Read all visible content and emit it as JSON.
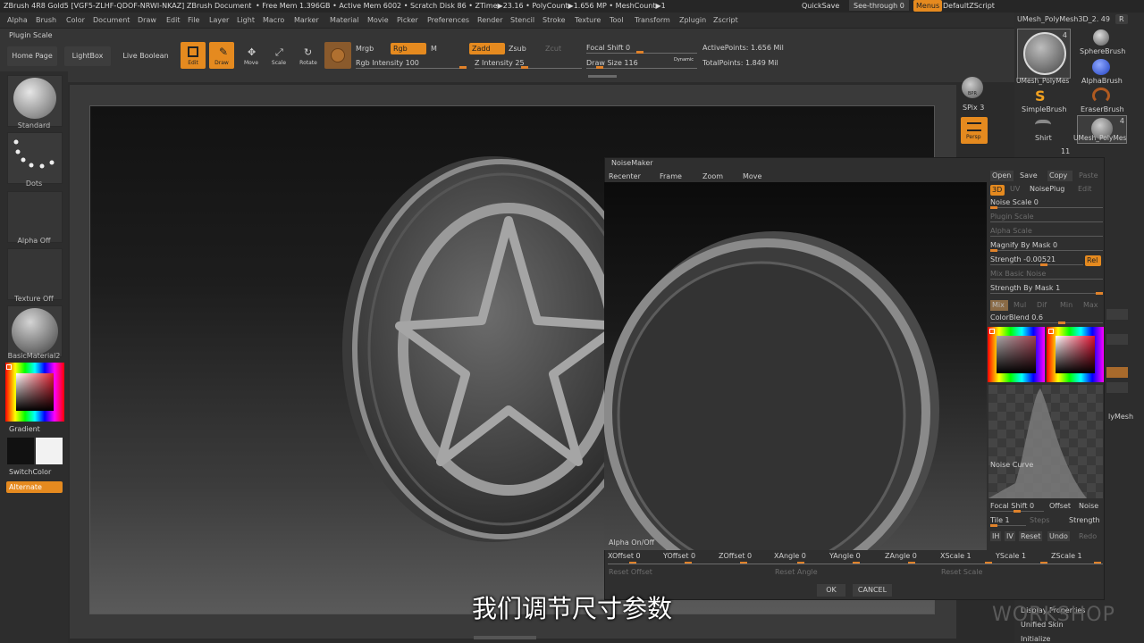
{
  "titlebar": {
    "app": "ZBrush 4R8 Gold5 [VGF5-ZLHF-QDOF-NRWI-NKAZ]  ZBrush Document",
    "stats": "• Free Mem 1.396GB • Active Mem 6002 • Scratch Disk 86 • ZTime▶23.16 • PolyCount▶1.656 MP • MeshCount▶1",
    "quicksave": "QuickSave",
    "seethrough": "See-through  0",
    "menus": "Menus",
    "script": "DefaultZScript"
  },
  "menubar": [
    "Alpha",
    "Brush",
    "Color",
    "Document",
    "Draw",
    "Edit",
    "File",
    "Layer",
    "Light",
    "Macro",
    "Marker",
    "Material",
    "Movie",
    "Picker",
    "Preferences",
    "Render",
    "Stencil",
    "Stroke",
    "Texture",
    "Tool",
    "Transform",
    "Zplugin",
    "Zscript"
  ],
  "shelf": {
    "plugin_scale": "Plugin Scale",
    "home_page": "Home Page",
    "lightbox": "LightBox",
    "live_boolean": "Live Boolean",
    "edit": "Edit",
    "draw": "Draw",
    "move": "Move",
    "scale": "Scale",
    "rotate": "Rotate",
    "mrgb": "Mrgb",
    "rgb": "Rgb",
    "m": "M",
    "rgb_intensity": "Rgb Intensity 100",
    "zadd": "Zadd",
    "zsub": "Zsub",
    "zcut": "Zcut",
    "z_intensity": "Z Intensity 25",
    "focal_shift": "Focal Shift 0",
    "draw_size": "Draw Size 116",
    "dynamic": "Dynamic",
    "active_points": "ActivePoints: 1.656 Mil",
    "total_points": "TotalPoints: 1.849 Mil"
  },
  "left": {
    "standard": "Standard",
    "dots": "Dots",
    "alpha_off": "Alpha Off",
    "texture_off": "Texture Off",
    "material": "BasicMaterial2",
    "gradient": "Gradient",
    "switchcolor": "SwitchColor",
    "alternate": "Alternate"
  },
  "canvas_right": {
    "bpr": "BPR",
    "spix": "SPix 3",
    "persp": "Persp"
  },
  "tool_panel": {
    "mesh_title": "UMesh_PolyMesh3D_2. 49",
    "r": "R",
    "items": [
      {
        "label": "UMesh_PolyMes",
        "count": "4"
      },
      {
        "label": "SphereBrush"
      },
      {
        "label": "AlphaBrush"
      },
      {
        "label": "SimpleBrush"
      },
      {
        "label": "EraserBrush"
      },
      {
        "label": "Shirt"
      },
      {
        "label": "UMesh_PolyMes",
        "count": "4"
      }
    ],
    "count_11": "11",
    "polymesh_partial": "lyMesh",
    "bottom": [
      "Display Properties",
      "Unified Skin",
      "Initialize"
    ]
  },
  "noisemaker": {
    "title": "NoiseMaker",
    "nav": [
      "Recenter",
      "Frame",
      "Zoom",
      "Move"
    ],
    "alpha_onoff": "Alpha On/Off",
    "open": "Open",
    "save": "Save",
    "copy": "Copy",
    "paste": "Paste",
    "mode_3d": "3D",
    "mode_uv": "UV",
    "noiseplug": "NoisePlug",
    "edit": "Edit",
    "noise_scale": "Noise Scale  0",
    "plugin_scale": "Plugin Scale",
    "alpha_scale": "Alpha Scale",
    "magnify_by_mask": "Magnify By Mask  0",
    "strength": "Strength  -0.00521",
    "rel": "Rel",
    "mix_basic_noise": "Mix Basic Noise",
    "strength_by_mask": "Strength By Mask  1",
    "blend_modes": [
      "Mix",
      "Mul",
      "Dif",
      "Min",
      "Max"
    ],
    "colorblend": "ColorBlend  0.6",
    "noise_curve": "Noise Curve",
    "focal_shift": "Focal Shift  0",
    "offset": "Offset",
    "noise": "Noise",
    "tile": "Tile  1",
    "steps": "Steps",
    "strength2": "Strength",
    "ih": "IH",
    "iv": "IV",
    "reset": "Reset",
    "undo": "Undo",
    "redo": "Redo",
    "params": [
      "XOffset  0",
      "YOffset  0",
      "ZOffset  0",
      "XAngle  0",
      "YAngle  0",
      "ZAngle  0",
      "XScale  1",
      "YScale  1",
      "ZScale  1"
    ],
    "reset_offset": "Reset Offset",
    "reset_angle": "Reset Angle",
    "reset_scale": "Reset Scale",
    "ok": "OK",
    "cancel": "CANCEL"
  },
  "subtitle": "我们调节尺寸参数",
  "watermark": "GNOMON WORKSHOP",
  "colors": {
    "accent": "#e58a1f",
    "panel": "#2f2f2f"
  }
}
